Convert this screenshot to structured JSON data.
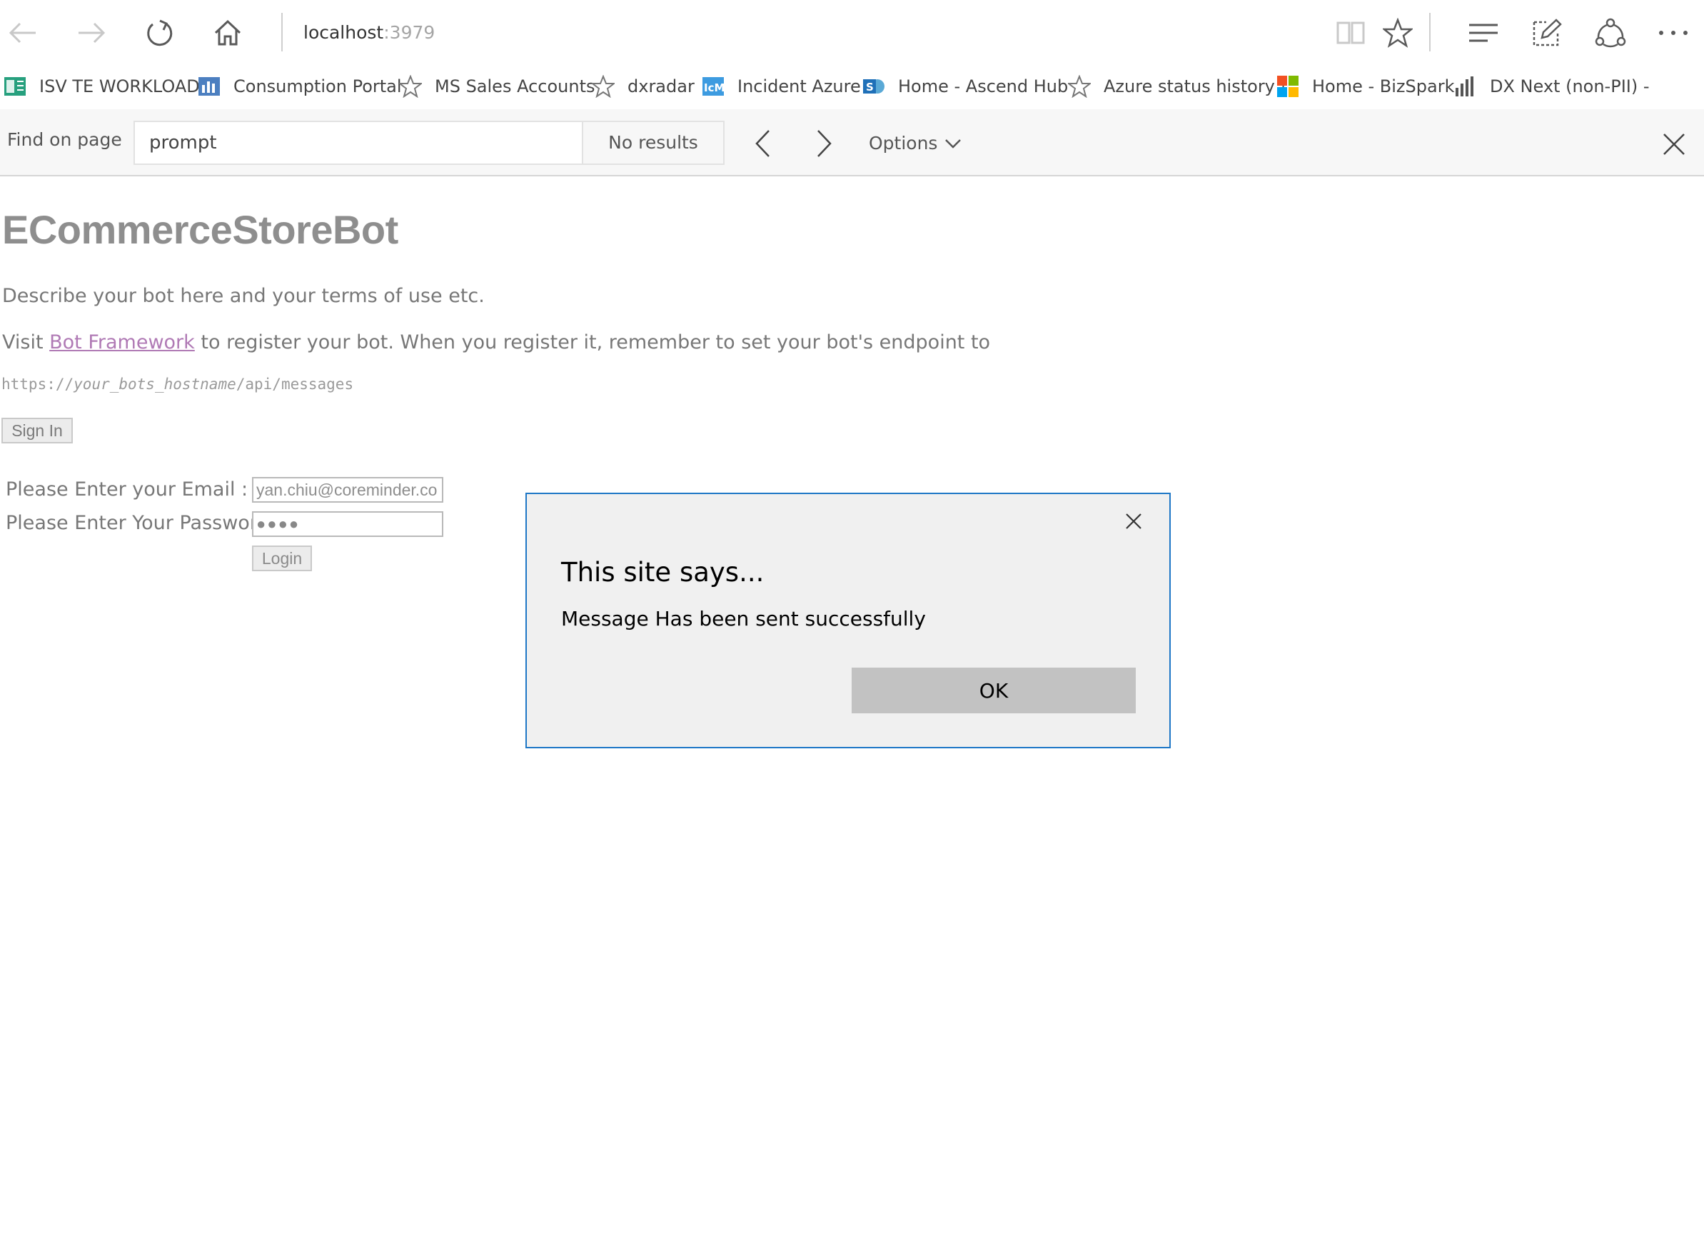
{
  "browser": {
    "url_host": "localhost",
    "url_port": ":3979",
    "toolbar_icons": [
      "back-icon",
      "forward-icon",
      "refresh-icon",
      "home-icon",
      "reading-view-icon",
      "favorite-star-icon",
      "hub-icon",
      "web-note-icon",
      "share-icon",
      "more-icon"
    ]
  },
  "favorites": [
    {
      "label": "ISV TE WORKLOAD",
      "icon": "spreadsheet-icon"
    },
    {
      "label": "Consumption Portal",
      "icon": "powerbi-icon"
    },
    {
      "label": "MS Sales Accounts",
      "icon": "star-icon"
    },
    {
      "label": "dxradar",
      "icon": "star-icon"
    },
    {
      "label": "Incident Azure",
      "icon": "icm-icon"
    },
    {
      "label": "Home - Ascend Hub",
      "icon": "sharepoint-icon"
    },
    {
      "label": "Azure status history |",
      "icon": "star-icon"
    },
    {
      "label": "Home - BizSpark",
      "icon": "microsoft-logo-icon"
    },
    {
      "label": "DX Next (non-PII) -",
      "icon": "bar-chart-icon"
    }
  ],
  "find": {
    "label": "Find on page",
    "query": "prompt",
    "status": "No results",
    "options_label": "Options"
  },
  "page": {
    "title": "ECommerceStoreBot",
    "description": "Describe your bot here and your terms of use etc.",
    "visit_prefix": "Visit ",
    "link_text": "Bot Framework",
    "visit_suffix": " to register your bot. When you register it, remember to set your bot's endpoint to",
    "endpoint_prefix": "https://",
    "endpoint_host": "your_bots_hostname",
    "endpoint_suffix": "/api/messages",
    "sign_in_label": "Sign In",
    "email_label": "Please Enter your Email :",
    "email_value": "yan.chiu@coreminder.co",
    "password_label": "Please Enter Your Password",
    "password_value": "●●●●",
    "login_label": "Login"
  },
  "dialog": {
    "title": "This site says...",
    "message": "Message Has been sent successfully",
    "ok_label": "OK"
  },
  "colors": {
    "dialog_border": "#1e77c6",
    "link": "#b07ab5",
    "ok_button": "#c2c2c2"
  }
}
